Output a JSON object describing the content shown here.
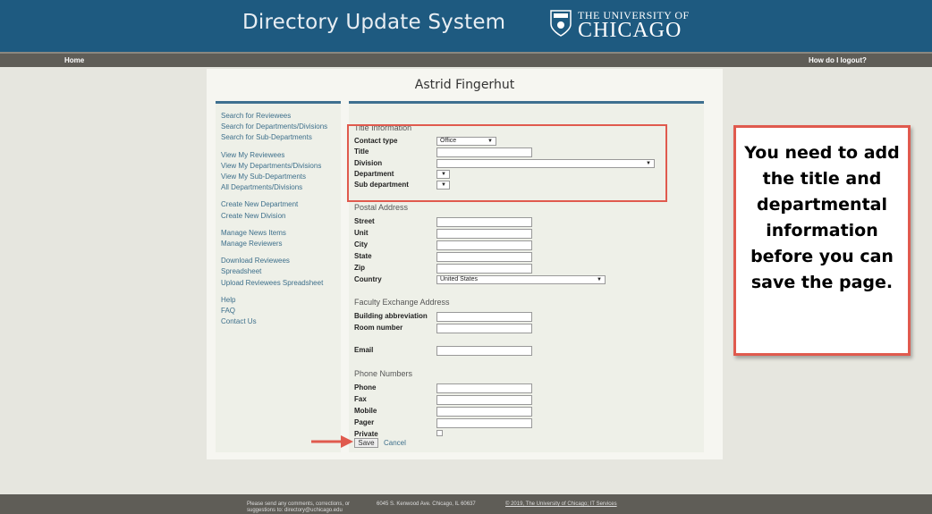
{
  "header": {
    "title": "Directory Update System",
    "logo_line1": "THE UNIVERSITY OF",
    "logo_line2": "CHICAGO"
  },
  "nav": {
    "home": "Home",
    "logout": "How do I logout?"
  },
  "page_title": "Astrid Fingerhut",
  "sidebar": {
    "groups": [
      [
        "Search for Reviewees",
        "Search for Departments/Divisions",
        "Search for Sub-Departments"
      ],
      [
        "View My Reviewees",
        "View My Departments/Divisions",
        "View My Sub-Departments",
        "All Departments/Divisions"
      ],
      [
        "Create New Department",
        "Create New Division"
      ],
      [
        "Manage News Items",
        "Manage Reviewers"
      ],
      [
        "Download Reviewees Spreadsheet",
        "Upload Reviewees Spreadsheet"
      ],
      [
        "Help",
        "FAQ",
        "Contact Us"
      ]
    ]
  },
  "form": {
    "title_info": "Title Information",
    "contact_type_label": "Contact type",
    "contact_type_value": "Office",
    "title_label": "Title",
    "division_label": "Division",
    "department_label": "Department",
    "subdept_label": "Sub department",
    "postal": "Postal Address",
    "street": "Street",
    "unit": "Unit",
    "city": "City",
    "state": "State",
    "zip": "Zip",
    "country": "Country",
    "country_value": "United States",
    "faculty": "Faculty Exchange Address",
    "building": "Building abbreviation",
    "room": "Room number",
    "email": "Email",
    "phones": "Phone Numbers",
    "phone": "Phone",
    "fax": "Fax",
    "mobile": "Mobile",
    "pager": "Pager",
    "private": "Private",
    "save": "Save",
    "cancel": "Cancel"
  },
  "callout": "You need to add the title and departmental information before you can save the page.",
  "footer": {
    "comments": "Please send any comments, corrections, or suggestions to: directory@uchicago.edu",
    "address": "6045 S. Kenwood Ave. Chicago, IL 60637",
    "copyright": "© 2019, The University of Chicago; IT Services"
  },
  "colors": {
    "header": "#1e5a80",
    "accent": "#e05a4e",
    "link": "#3d6f8b"
  }
}
